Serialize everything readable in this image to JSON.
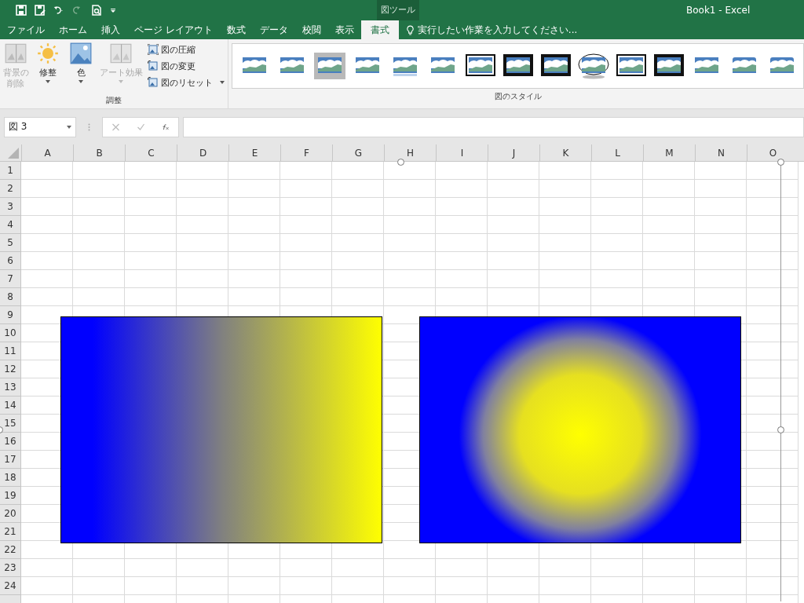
{
  "title_bar": {
    "context_label": "図ツール",
    "title": "Book1 - Excel"
  },
  "tabs": [
    {
      "label": "ファイル",
      "selected": false
    },
    {
      "label": "ホーム",
      "selected": false
    },
    {
      "label": "挿入",
      "selected": false
    },
    {
      "label": "ページ レイアウト",
      "selected": false
    },
    {
      "label": "数式",
      "selected": false
    },
    {
      "label": "データ",
      "selected": false
    },
    {
      "label": "校閲",
      "selected": false
    },
    {
      "label": "表示",
      "selected": false
    },
    {
      "label": "書式",
      "selected": true
    }
  ],
  "tell_me": {
    "placeholder": "実行したい作業を入力してください..."
  },
  "ribbon": {
    "adjust_group": {
      "label": "調整",
      "large_buttons": [
        {
          "label": "背景の削除",
          "disabled": true,
          "dropdown": false
        },
        {
          "label": "修整",
          "disabled": false,
          "dropdown": true
        },
        {
          "label": "色",
          "disabled": false,
          "dropdown": true
        },
        {
          "label": "アート効果",
          "disabled": true,
          "dropdown": true
        }
      ],
      "small_buttons": [
        {
          "label": "図の圧縮",
          "dropdown": false
        },
        {
          "label": "図の変更",
          "dropdown": false
        },
        {
          "label": "図のリセット",
          "dropdown": true
        }
      ]
    },
    "styles_group": {
      "label": "図のスタイル"
    }
  },
  "formula_bar": {
    "name_box": "図 3"
  },
  "sheet": {
    "columns": [
      "A",
      "B",
      "C",
      "D",
      "E",
      "F",
      "G",
      "H",
      "I",
      "J",
      "K",
      "L",
      "M",
      "N",
      "O"
    ],
    "rows": [
      "1",
      "2",
      "3",
      "4",
      "5",
      "6",
      "7",
      "8",
      "9",
      "10",
      "11",
      "12",
      "13",
      "14",
      "15",
      "16",
      "17",
      "18",
      "19",
      "20",
      "21",
      "22",
      "23",
      "24"
    ]
  }
}
